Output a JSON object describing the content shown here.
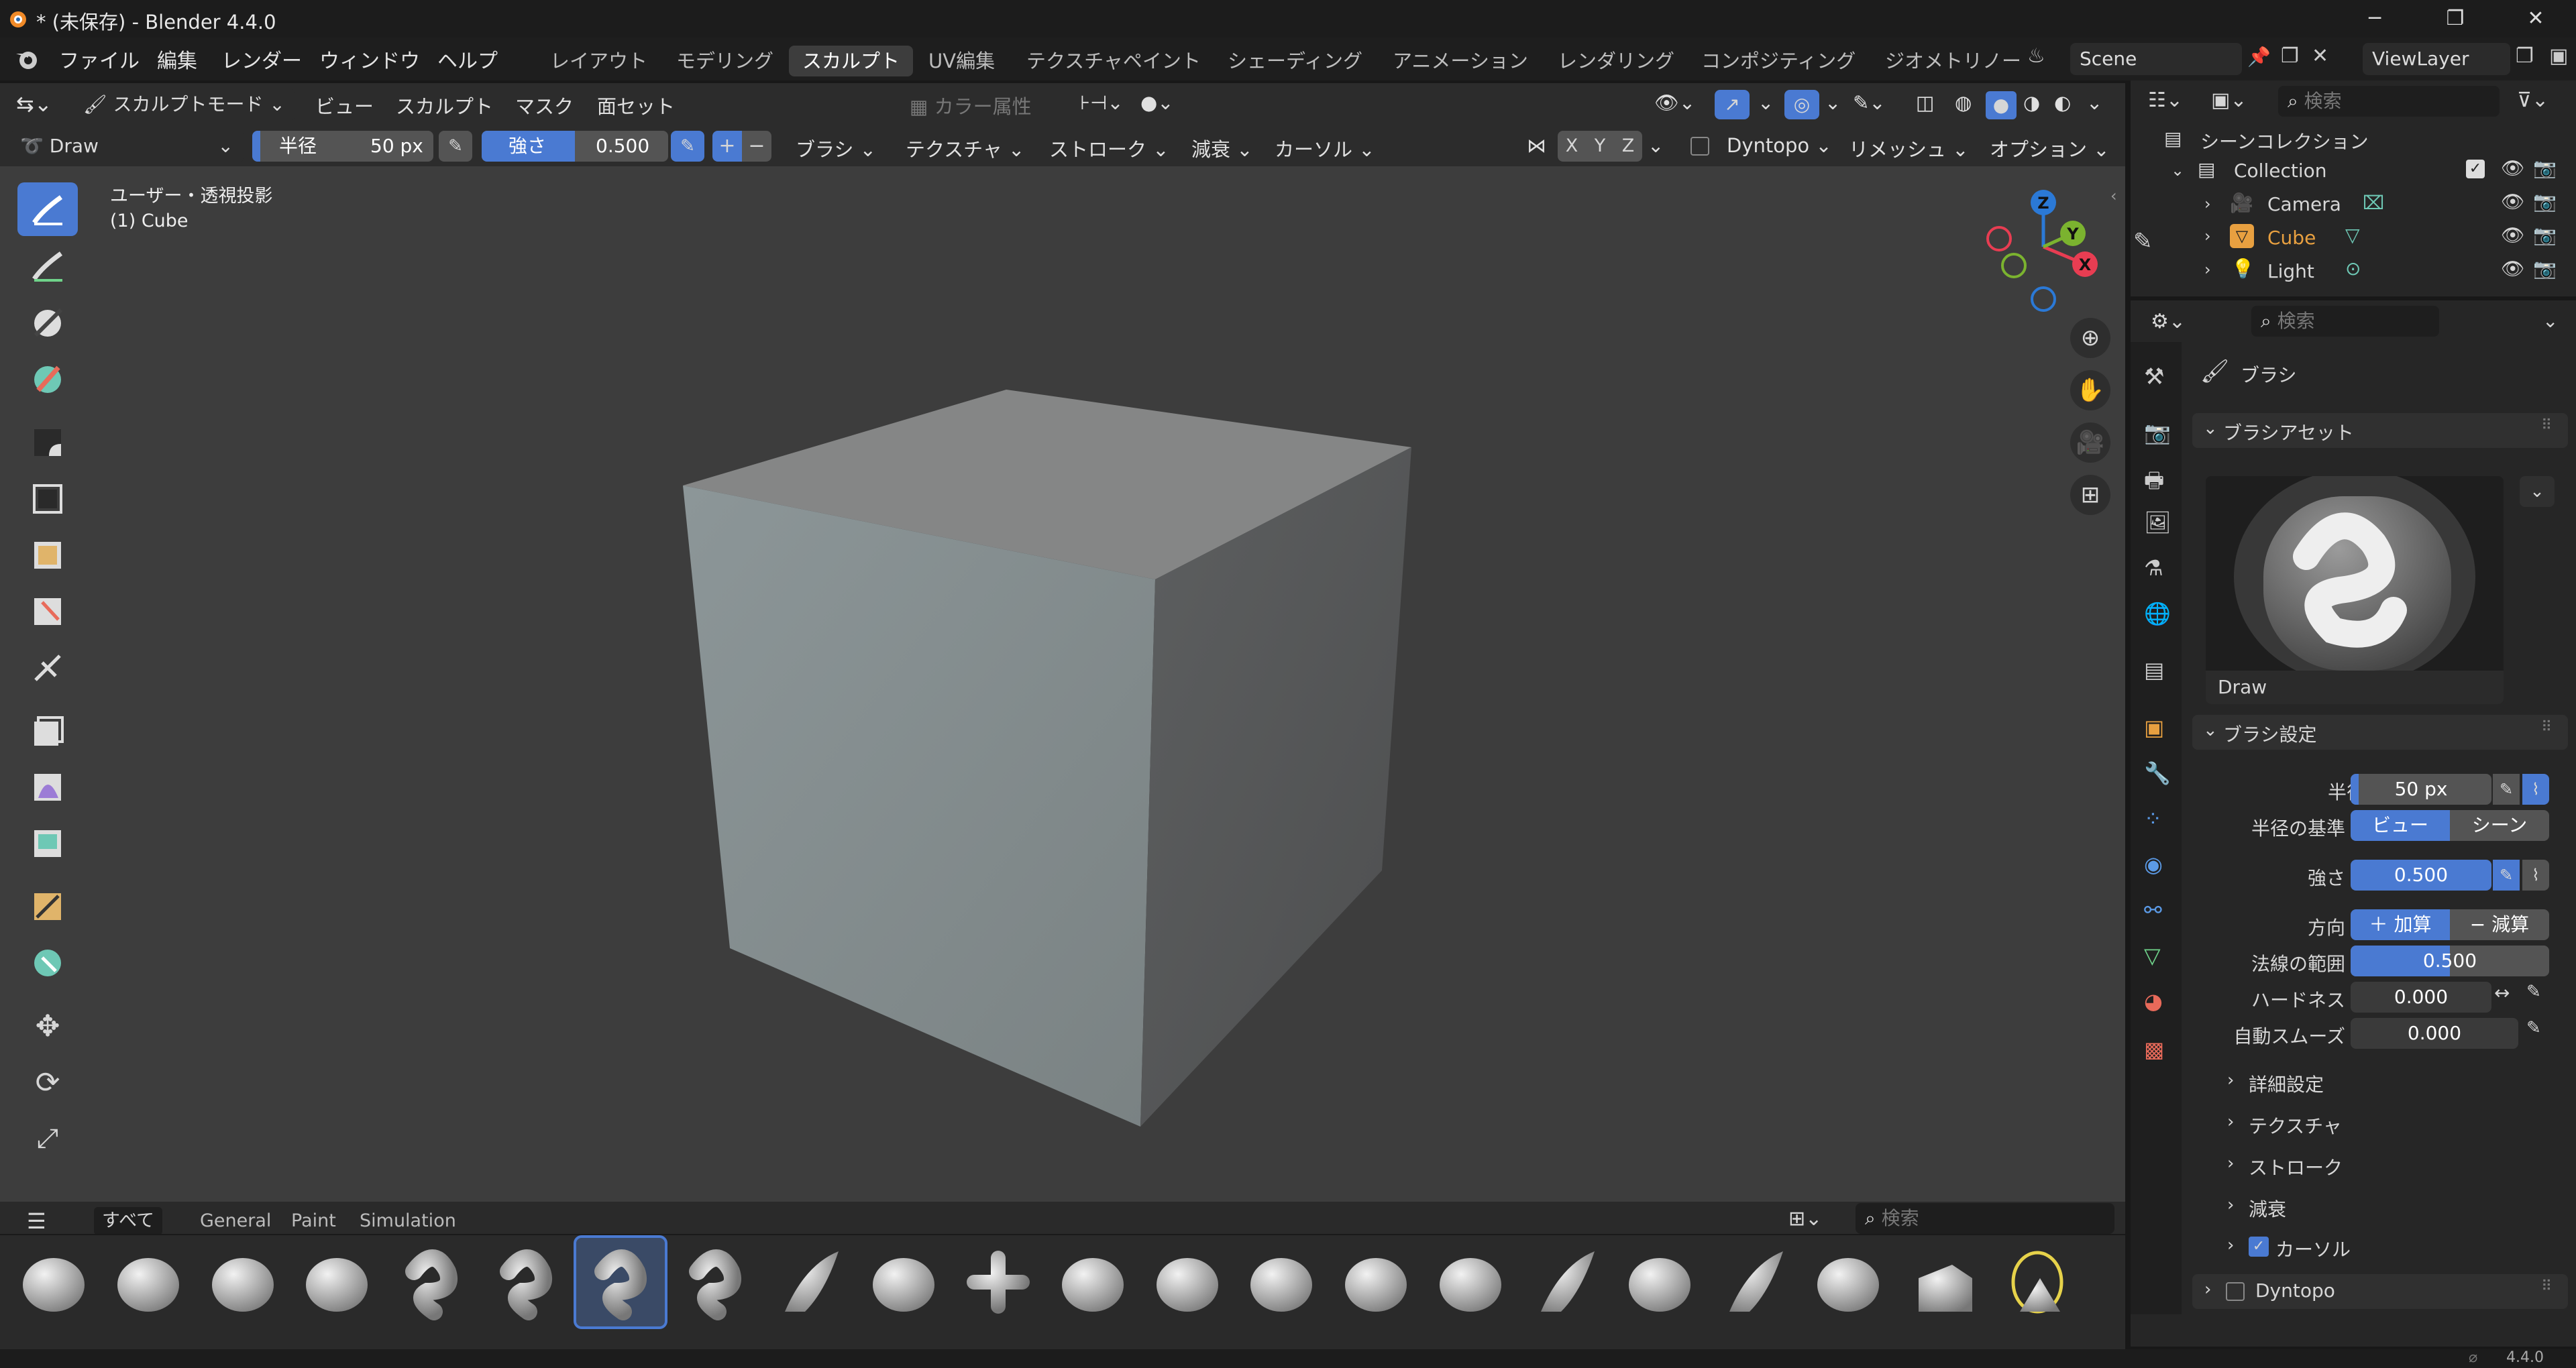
{
  "window": {
    "title": "* (未保存) - Blender 4.4.0",
    "minimize": "─",
    "maximize": "❐",
    "close": "✕"
  },
  "menubar": {
    "items": [
      "ファイル",
      "編集",
      "レンダー",
      "ウィンドウ",
      "ヘルプ"
    ],
    "workspaces": [
      "レイアウト",
      "モデリング",
      "スカルプト",
      "UV編集",
      "テクスチャペイント",
      "シェーディング",
      "アニメーション",
      "レンダリング",
      "コンポジティング",
      "ジオメトリノー"
    ],
    "active_workspace": "スカルプト",
    "scene": "Scene",
    "view_layer": "ViewLayer"
  },
  "viewport_header": {
    "mode": "スカルプトモード",
    "menus": [
      "ビュー",
      "スカルプト",
      "マスク",
      "面セット"
    ],
    "color_attr": "カラー属性"
  },
  "tool_header": {
    "brush_name": "Draw",
    "radius_label": "半径",
    "radius_value": "50 px",
    "strength_label": "強さ",
    "strength_value": "0.500",
    "menus": [
      "ブラシ",
      "テクスチャ",
      "ストローク",
      "減衰",
      "カーソル"
    ],
    "axes": [
      "X",
      "Y",
      "Z"
    ],
    "dyntopo": "Dyntopo",
    "remesh": "リメッシュ",
    "options": "オプション"
  },
  "viewport": {
    "projection": "ユーザー・透視投影",
    "object": "(1) Cube",
    "gizmo": {
      "x": "X",
      "y": "Y",
      "z": "Z"
    }
  },
  "asset_shelf": {
    "tabs": [
      "すべて",
      "General",
      "Paint",
      "Simulation"
    ],
    "search_placeholder": "検索"
  },
  "outliner": {
    "search_placeholder": "検索",
    "scene_collection": "シーンコレクション",
    "collection": "Collection",
    "items": [
      {
        "name": "Camera"
      },
      {
        "name": "Cube"
      },
      {
        "name": "Light"
      }
    ]
  },
  "properties": {
    "search_placeholder": "検索",
    "header": "ブラシ",
    "asset_panel": "ブラシアセット",
    "asset_name": "Draw",
    "settings_panel": "ブラシ設定",
    "radius_label": "半径",
    "radius_value": "50 px",
    "radius_unit_label": "半径の基準",
    "radius_unit_view": "ビュー",
    "radius_unit_scene": "シーン",
    "strength_label": "強さ",
    "strength_value": "0.500",
    "direction_label": "方向",
    "direction_add": "加算",
    "direction_sub": "減算",
    "normal_radius_label": "法線の範囲",
    "normal_radius_value": "0.500",
    "normal_radius_fraction": 0.5,
    "hardness_label": "ハードネス",
    "hardness_value": "0.000",
    "autosmooth_label": "自動スムーズ",
    "autosmooth_value": "0.000",
    "subpanels": [
      "詳細設定",
      "テクスチャ",
      "ストローク",
      "減衰",
      "カーソル"
    ],
    "dyntopo_panel": "Dyntopo"
  },
  "statusbar": {
    "version": "4.4.0"
  },
  "colors": {
    "accent": "#4a7ad2",
    "cube_highlight": "#e8a040",
    "x_axis": "#e83d52",
    "y_axis": "#7bb32f",
    "z_axis": "#2b79d6"
  }
}
